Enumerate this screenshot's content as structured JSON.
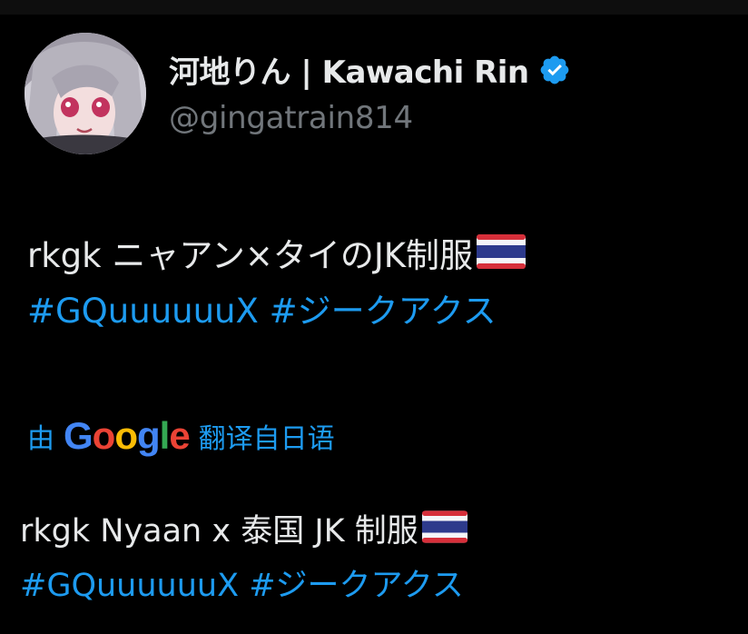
{
  "author": {
    "display_name": "河地りん | Kawachi Rin",
    "handle": "@gingatrain814",
    "verified": true
  },
  "tweet": {
    "text": "rkgk ニャアン×タイのJK制服",
    "flag": "thailand-flag",
    "hashtags": [
      "#GQuuuuuuX",
      "#ジークアクス"
    ]
  },
  "translation": {
    "prefix": "由",
    "provider": "Google",
    "suffix": "翻译自日语",
    "text": "rkgk Nyaan x 泰国 JK 制服",
    "hashtags": [
      "#GQuuuuuuX",
      "#ジークアクス"
    ]
  },
  "colors": {
    "background": "#000000",
    "text": "#e7e9ea",
    "muted": "#71767b",
    "link": "#1d9bf0",
    "verified": "#1d9bf0"
  }
}
